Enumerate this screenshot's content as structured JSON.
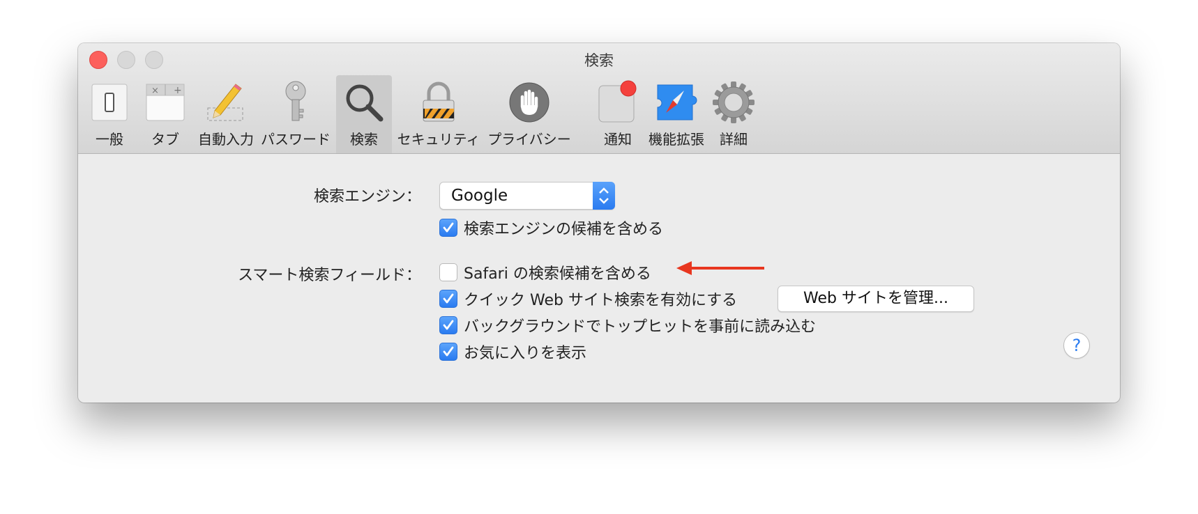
{
  "window": {
    "title": "検索",
    "traffic_lights": [
      "close-button",
      "minimize-button",
      "zoom-button"
    ]
  },
  "toolbar": {
    "selected": "検索",
    "tabs": [
      {
        "label": "一般",
        "icon": "switch-icon"
      },
      {
        "label": "タブ",
        "icon": "tabs-icon"
      },
      {
        "label": "自動入力",
        "icon": "pencil-icon"
      },
      {
        "label": "パスワード",
        "icon": "key-icon"
      },
      {
        "label": "検索",
        "icon": "magnifier-icon"
      },
      {
        "label": "セキュリティ",
        "icon": "lock-icon"
      },
      {
        "label": "プライバシー",
        "icon": "hand-icon"
      },
      {
        "label": "通知",
        "icon": "notification-icon"
      },
      {
        "label": "機能拡張",
        "icon": "compass-icon"
      },
      {
        "label": "詳細",
        "icon": "gear-icon"
      }
    ]
  },
  "search_engine": {
    "label": "検索エンジン：",
    "selected": "Google",
    "include_suggestions": {
      "label": "検索エンジンの候補を含める",
      "checked": true
    }
  },
  "smart_search_field": {
    "label": "スマート検索フィールド：",
    "options": [
      {
        "label": "Safari の検索候補を含める",
        "checked": false
      },
      {
        "label": "クイック Web サイト検索を有効にする",
        "checked": true
      },
      {
        "label": "バックグラウンドでトップヒットを事前に読み込む",
        "checked": true
      },
      {
        "label": "お気に入りを表示",
        "checked": true
      }
    ],
    "manage_button": "Web サイトを管理..."
  },
  "help_button": "?",
  "colors": {
    "accent": "#2a7bf0",
    "annotation_arrow": "#e8361f",
    "close_button": "#fc605c"
  }
}
